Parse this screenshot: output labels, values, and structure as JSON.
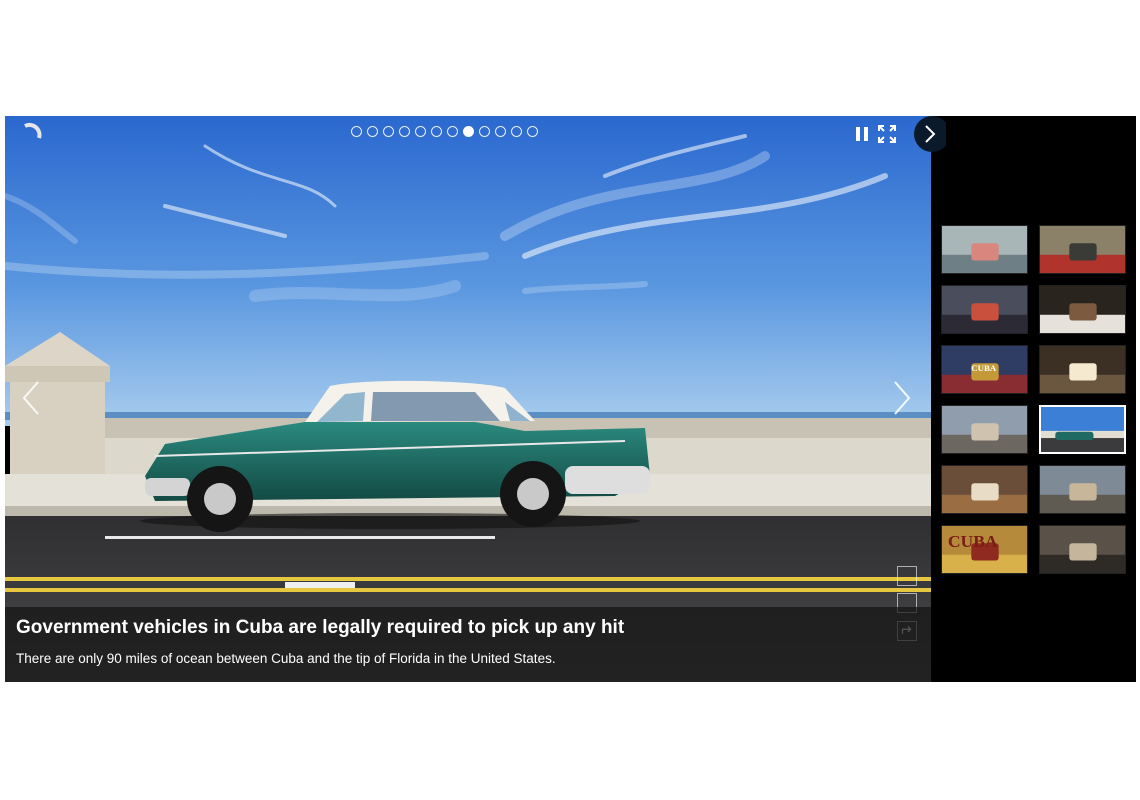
{
  "slideshow": {
    "slide_count": 12,
    "active_index": 7,
    "caption": {
      "title": "Government vehicles in Cuba are legally required to pick up any hit",
      "description": "There are only 90 miles of ocean between Cuba and the tip of Florida in the United States."
    }
  },
  "thumbnails": [
    {
      "scene": "colorful street with pink car"
    },
    {
      "scene": "colonial building with red car"
    },
    {
      "scene": "woman with cigar"
    },
    {
      "scene": "portrait of a man"
    },
    {
      "scene": "shop sign CUBA"
    },
    {
      "scene": "sunlit street"
    },
    {
      "scene": "ornate building facade"
    },
    {
      "scene": "green car on Malecon",
      "selected": true
    },
    {
      "scene": "cigar making"
    },
    {
      "scene": "city plaza"
    },
    {
      "scene": "CUBA sign"
    },
    {
      "scene": "narrow old street"
    }
  ],
  "thumb_sign_text": "CUBA",
  "colors": {
    "sky_top": "#2f6fd1",
    "sky_bottom": "#9cc6ef",
    "car": "#1f6a63",
    "road": "#3b3b3d",
    "road_line": "#e7c740",
    "panel_bg": "#000000"
  },
  "icons": {
    "loader": "spinner-icon",
    "pause": "pause-icon",
    "fullscreen": "fullscreen-icon",
    "next_tab": "chevron-right-icon",
    "prev": "chevron-left-icon",
    "next": "chevron-right-icon",
    "share": "share-icon"
  }
}
